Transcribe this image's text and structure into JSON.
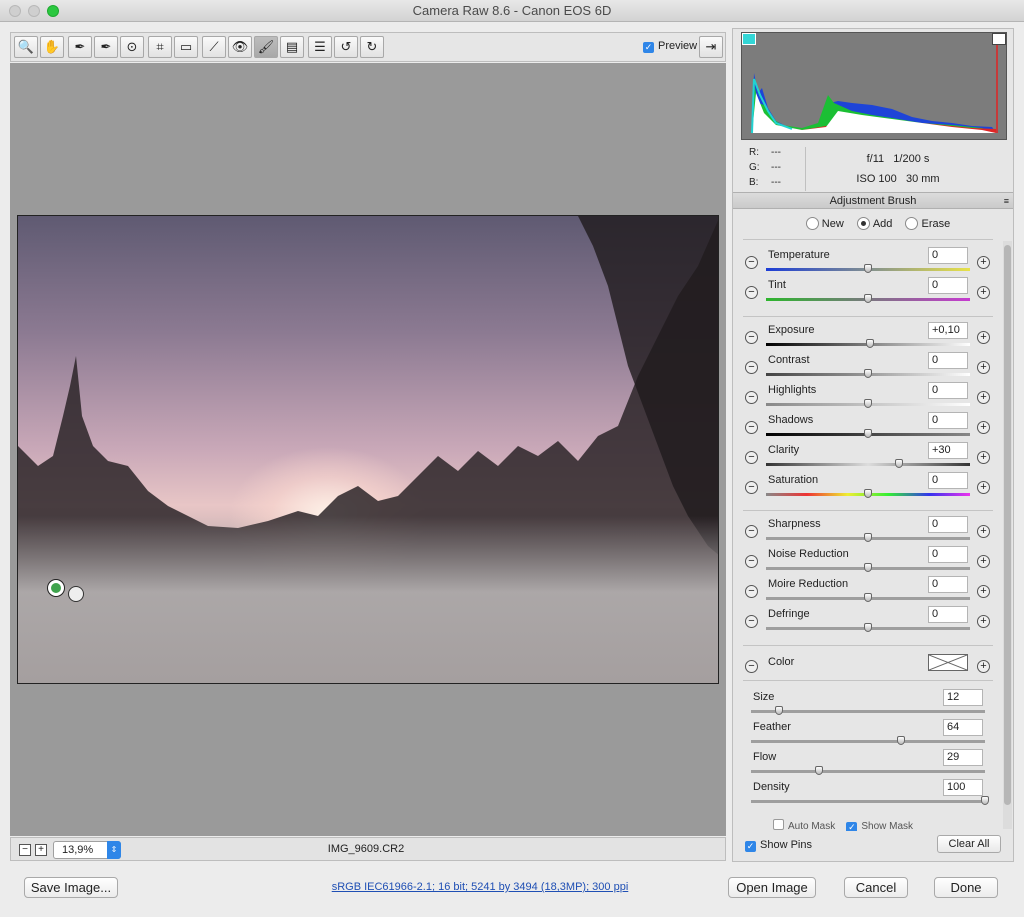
{
  "window": {
    "title": "Camera Raw 8.6  -  Canon EOS 6D"
  },
  "toolbar": {
    "tools": [
      {
        "name": "zoom-tool",
        "glyph": "🔍"
      },
      {
        "name": "hand-tool",
        "glyph": "✋"
      },
      {
        "name": "white-balance-tool",
        "glyph": "✒"
      },
      {
        "name": "color-sampler-tool",
        "glyph": "✒"
      },
      {
        "name": "targeted-adjustment-tool",
        "glyph": "⊙"
      },
      {
        "name": "crop-tool",
        "glyph": "⌗"
      },
      {
        "name": "straighten-tool",
        "glyph": "▭"
      },
      {
        "name": "spot-removal-tool",
        "glyph": "⟋"
      },
      {
        "name": "red-eye-tool",
        "glyph": "👁"
      },
      {
        "name": "adjustment-brush-tool",
        "glyph": "🖌"
      },
      {
        "name": "graduated-filter-tool",
        "glyph": "▤"
      },
      {
        "name": "preferences-tool",
        "glyph": "☰"
      },
      {
        "name": "rotate-ccw-tool",
        "glyph": "↺"
      },
      {
        "name": "rotate-cw-tool",
        "glyph": "↻"
      }
    ],
    "preview_label": "Preview",
    "fullscreen_glyph": "⇥"
  },
  "status": {
    "zoom": "13,9%",
    "filename": "IMG_9609.CR2",
    "zoom_out": "−",
    "zoom_in": "+"
  },
  "info": {
    "r_label": "R:",
    "g_label": "G:",
    "b_label": "B:",
    "r_value": "---",
    "g_value": "---",
    "b_value": "---",
    "aperture": "f/11",
    "shutter": "1/200 s",
    "iso": "ISO 100",
    "focal": "30 mm"
  },
  "panel": {
    "title": "Adjustment Brush",
    "modes": {
      "new": "New",
      "add": "Add",
      "erase": "Erase"
    },
    "sliders": [
      {
        "id": "temperature",
        "label": "Temperature",
        "value": "0",
        "pos": 0.5
      },
      {
        "id": "tint",
        "label": "Tint",
        "value": "0",
        "pos": 0.5
      },
      {
        "id": "exposure",
        "label": "Exposure",
        "value": "+0,10",
        "pos": 0.51
      },
      {
        "id": "contrast",
        "label": "Contrast",
        "value": "0",
        "pos": 0.5
      },
      {
        "id": "highlights",
        "label": "Highlights",
        "value": "0",
        "pos": 0.5
      },
      {
        "id": "shadows",
        "label": "Shadows",
        "value": "0",
        "pos": 0.5
      },
      {
        "id": "clarity",
        "label": "Clarity",
        "value": "+30",
        "pos": 0.65
      },
      {
        "id": "saturation",
        "label": "Saturation",
        "value": "0",
        "pos": 0.5
      },
      {
        "id": "sharpness",
        "label": "Sharpness",
        "value": "0",
        "pos": 0.5
      },
      {
        "id": "noise-reduction",
        "label": "Noise Reduction",
        "value": "0",
        "pos": 0.5
      },
      {
        "id": "moire-reduction",
        "label": "Moire Reduction",
        "value": "0",
        "pos": 0.5
      },
      {
        "id": "defringe",
        "label": "Defringe",
        "value": "0",
        "pos": 0.5
      }
    ],
    "color_label": "Color",
    "brush": [
      {
        "id": "size",
        "label": "Size",
        "value": "12",
        "pos": 0.12
      },
      {
        "id": "feather",
        "label": "Feather",
        "value": "64",
        "pos": 0.64
      },
      {
        "id": "flow",
        "label": "Flow",
        "value": "29",
        "pos": 0.29
      },
      {
        "id": "density",
        "label": "Density",
        "value": "100",
        "pos": 1.0
      }
    ],
    "auto_mask": "Auto Mask",
    "show_mask": "Show Mask",
    "show_pins": "Show Pins",
    "clear_all": "Clear All"
  },
  "footer": {
    "save": "Save Image...",
    "workflow": "sRGB IEC61966-2.1; 16 bit; 5241 by 3494 (18,3MP); 300 ppi",
    "open": "Open Image",
    "cancel": "Cancel",
    "done": "Done"
  }
}
